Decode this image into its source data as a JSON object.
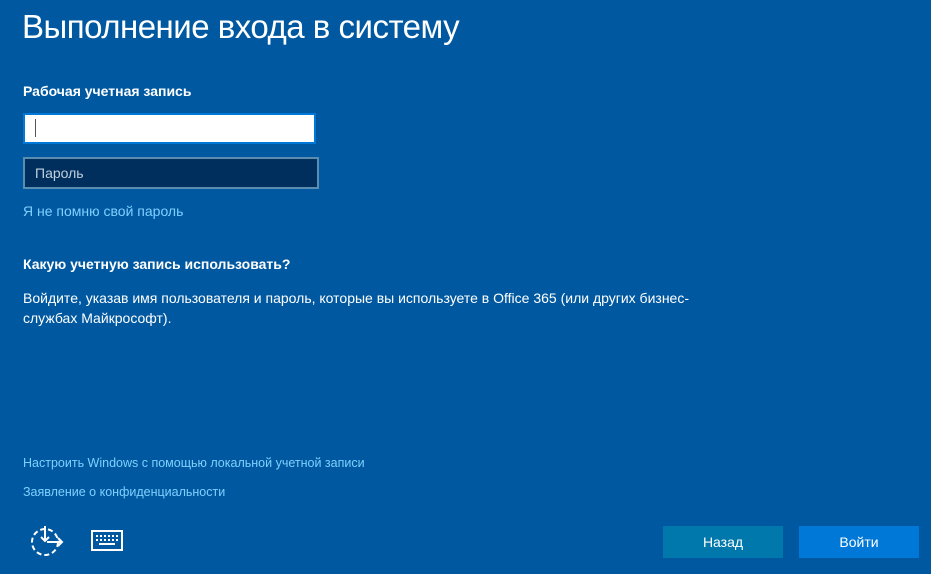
{
  "title": "Выполнение входа в систему",
  "account_label": "Рабочая учетная запись",
  "email": {
    "value": "",
    "placeholder": ""
  },
  "password": {
    "placeholder": "Пароль"
  },
  "forgot_link": "Я не помню свой пароль",
  "question": "Какую учетную запись использовать?",
  "description": "Войдите, указав имя пользователя и пароль, которые вы используете в Office 365 (или других бизнес-службах Майкрософт).",
  "local_account_link": "Настроить Windows с помощью локальной учетной записи",
  "privacy_link": "Заявление о конфиденциальности",
  "buttons": {
    "back": "Назад",
    "signin": "Войти"
  },
  "icons": {
    "ease": "ease-of-access-icon",
    "keyboard": "keyboard-icon"
  },
  "colors": {
    "background": "#0059a0",
    "primary": "#0078d7",
    "link": "#7fd0ff"
  }
}
